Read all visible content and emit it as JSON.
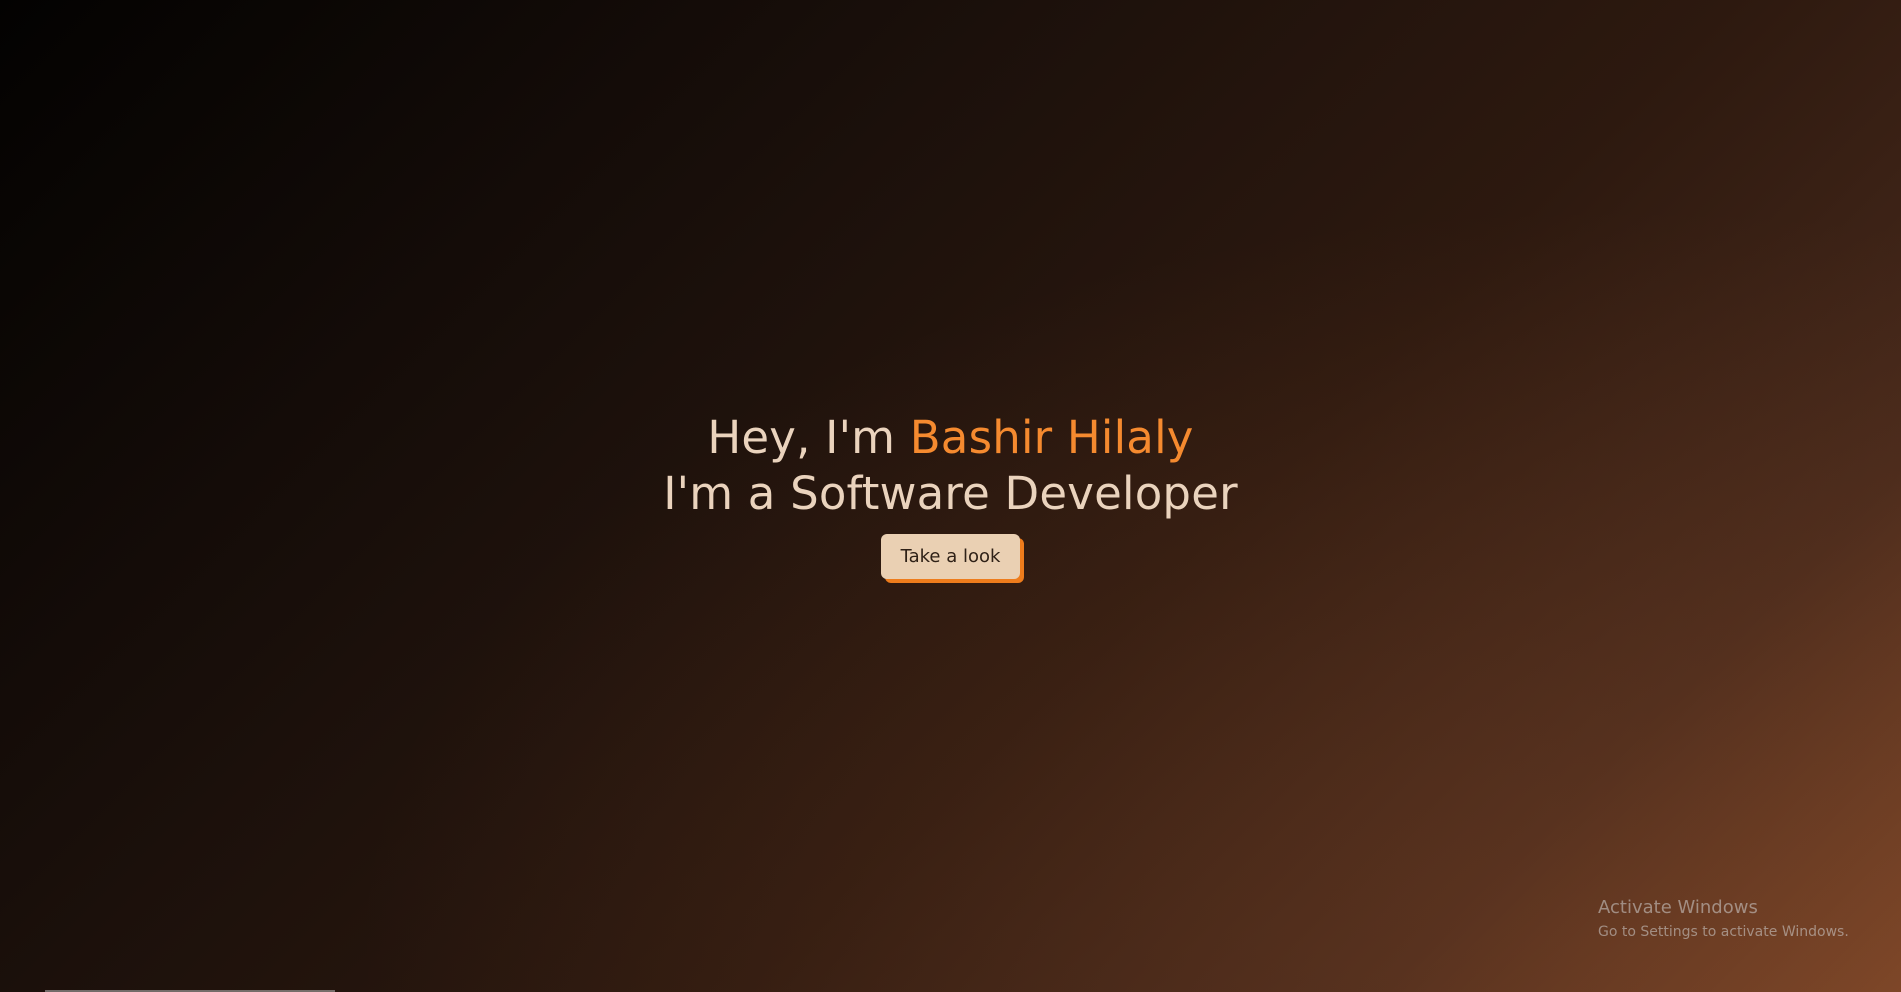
{
  "hero": {
    "greeting_prefix": "Hey, I'm ",
    "name": "Bashir Hilaly",
    "subtitle": "I'm a Software Developer",
    "cta_label": "Take a look"
  },
  "watermark": {
    "title": "Activate Windows",
    "subtitle": "Go to Settings to activate Windows."
  },
  "colors": {
    "accent": "#f58a2f",
    "text": "#ead3bd",
    "button_bg": "#ead0b3",
    "button_shadow": "#ee7c1c"
  }
}
